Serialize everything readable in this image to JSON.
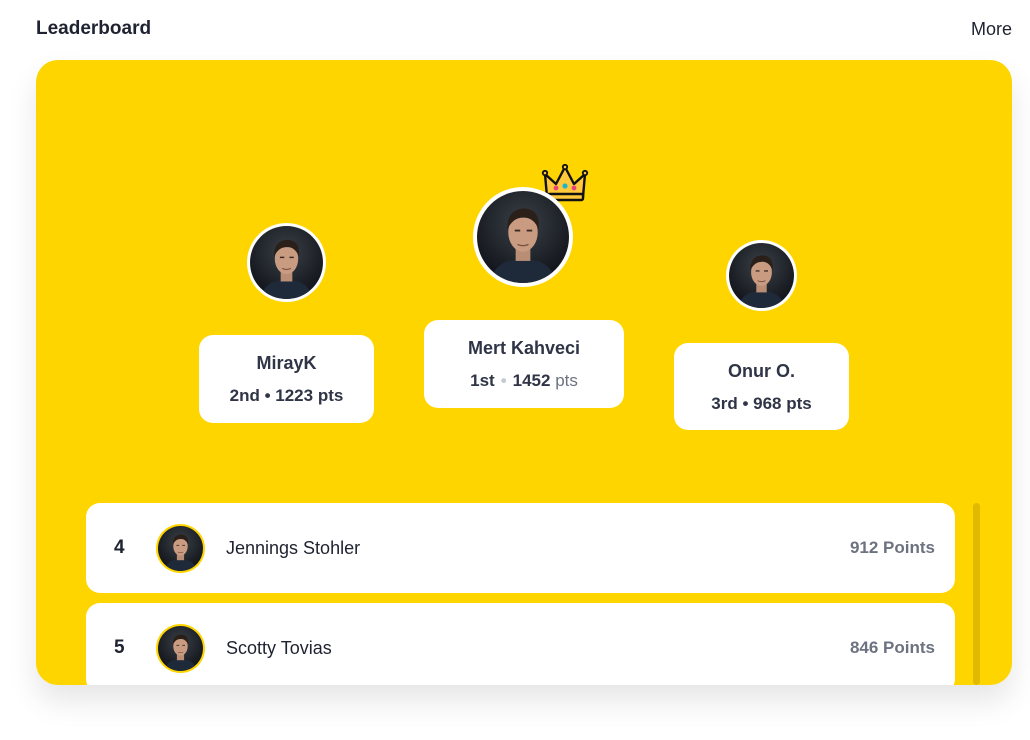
{
  "header": {
    "title": "Leaderboard",
    "more_label": "More"
  },
  "podium": {
    "first": {
      "name": "Mert Kahveci",
      "rank": "1st",
      "points": "1452",
      "unit": "pts"
    },
    "second": {
      "name": "MirayK",
      "stats": "2nd • 1223 pts"
    },
    "third": {
      "name": "Onur O.",
      "stats": "3rd • 968 pts"
    }
  },
  "list": [
    {
      "rank": "4",
      "name": "Jennings Stohler",
      "points": "912 Points"
    },
    {
      "rank": "5",
      "name": "Scotty Tovias",
      "points": "846 Points"
    }
  ],
  "icons": {
    "crown": "crown-icon",
    "avatar": "avatar"
  },
  "colors": {
    "card_background": "#ffd500",
    "text_primary": "#1f2230",
    "text_secondary": "#6c7280",
    "surface": "#ffffff",
    "avatar_ring": "#ffd500"
  }
}
